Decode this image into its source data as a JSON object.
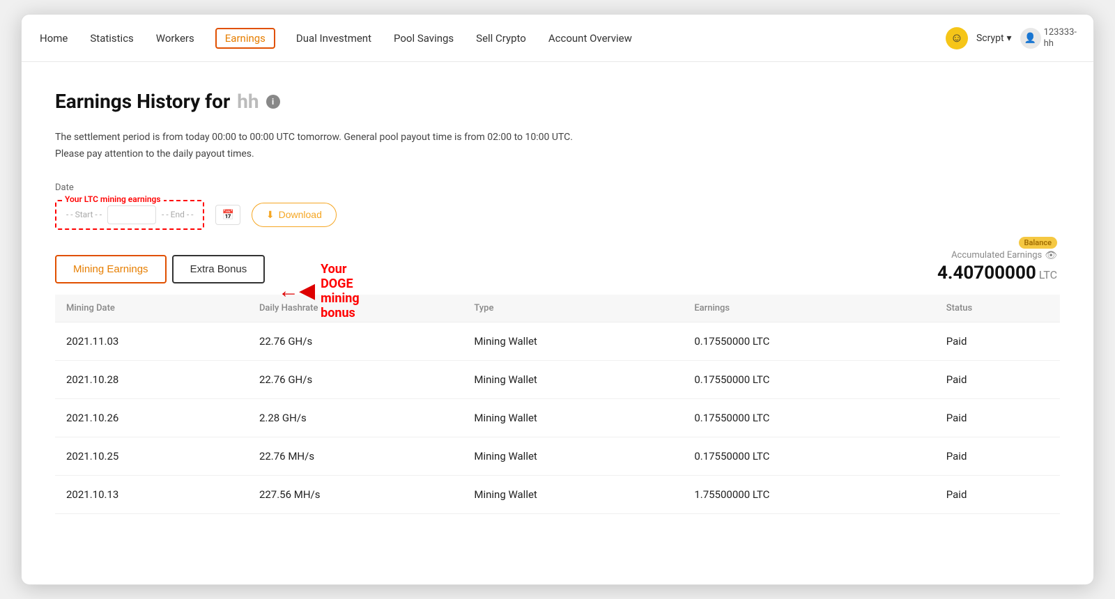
{
  "navbar": {
    "items": [
      {
        "label": "Home",
        "id": "home",
        "active": false
      },
      {
        "label": "Statistics",
        "id": "statistics",
        "active": false
      },
      {
        "label": "Workers",
        "id": "workers",
        "active": false
      },
      {
        "label": "Earnings",
        "id": "earnings",
        "active": true
      },
      {
        "label": "Dual Investment",
        "id": "dual-investment",
        "active": false
      },
      {
        "label": "Pool Savings",
        "id": "pool-savings",
        "active": false
      },
      {
        "label": "Sell Crypto",
        "id": "sell-crypto",
        "active": false
      },
      {
        "label": "Account Overview",
        "id": "account-overview",
        "active": false
      }
    ],
    "scrypt_label": "Scrypt",
    "username": "123333-",
    "username_sub": "hh"
  },
  "page": {
    "title_prefix": "Earnings History for",
    "title_masked": "hh",
    "info_icon": "i",
    "settlement_text": "The settlement period is from today 00:00 to 00:00 UTC tomorrow. General pool payout time is from 02:00 to 10:00 UTC.",
    "settlement_text2": "Please pay attention to the daily payout times.",
    "date_label": "Date",
    "date_start_placeholder": "Start",
    "date_end_placeholder": "End",
    "download_label": "Download",
    "ltc_annotation": "Your LTC mining earnings",
    "doge_annotation": "Your DOGE mining bonus",
    "tabs": [
      {
        "label": "Mining Earnings",
        "active": true
      },
      {
        "label": "Extra Bonus",
        "active": false
      }
    ],
    "balance_badge": "Balance",
    "accumulated_label": "Accumulated Earnings",
    "accumulated_value": "4.40700000",
    "accumulated_unit": "LTC",
    "table": {
      "headers": [
        "Mining Date",
        "Daily Hashrate",
        "Type",
        "Earnings",
        "Status"
      ],
      "rows": [
        {
          "date": "2021.11.03",
          "hashrate": "22.76 GH/s",
          "type": "Mining Wallet",
          "earnings": "0.17550000 LTC",
          "status": "Paid"
        },
        {
          "date": "2021.10.28",
          "hashrate": "22.76 GH/s",
          "type": "Mining Wallet",
          "earnings": "0.17550000 LTC",
          "status": "Paid"
        },
        {
          "date": "2021.10.26",
          "hashrate": "2.28 GH/s",
          "type": "Mining Wallet",
          "earnings": "0.17550000 LTC",
          "status": "Paid"
        },
        {
          "date": "2021.10.25",
          "hashrate": "22.76 MH/s",
          "type": "Mining Wallet",
          "earnings": "0.17550000 LTC",
          "status": "Paid"
        },
        {
          "date": "2021.10.13",
          "hashrate": "227.56 MH/s",
          "type": "Mining Wallet",
          "earnings": "1.75500000 LTC",
          "status": "Paid"
        }
      ]
    }
  }
}
